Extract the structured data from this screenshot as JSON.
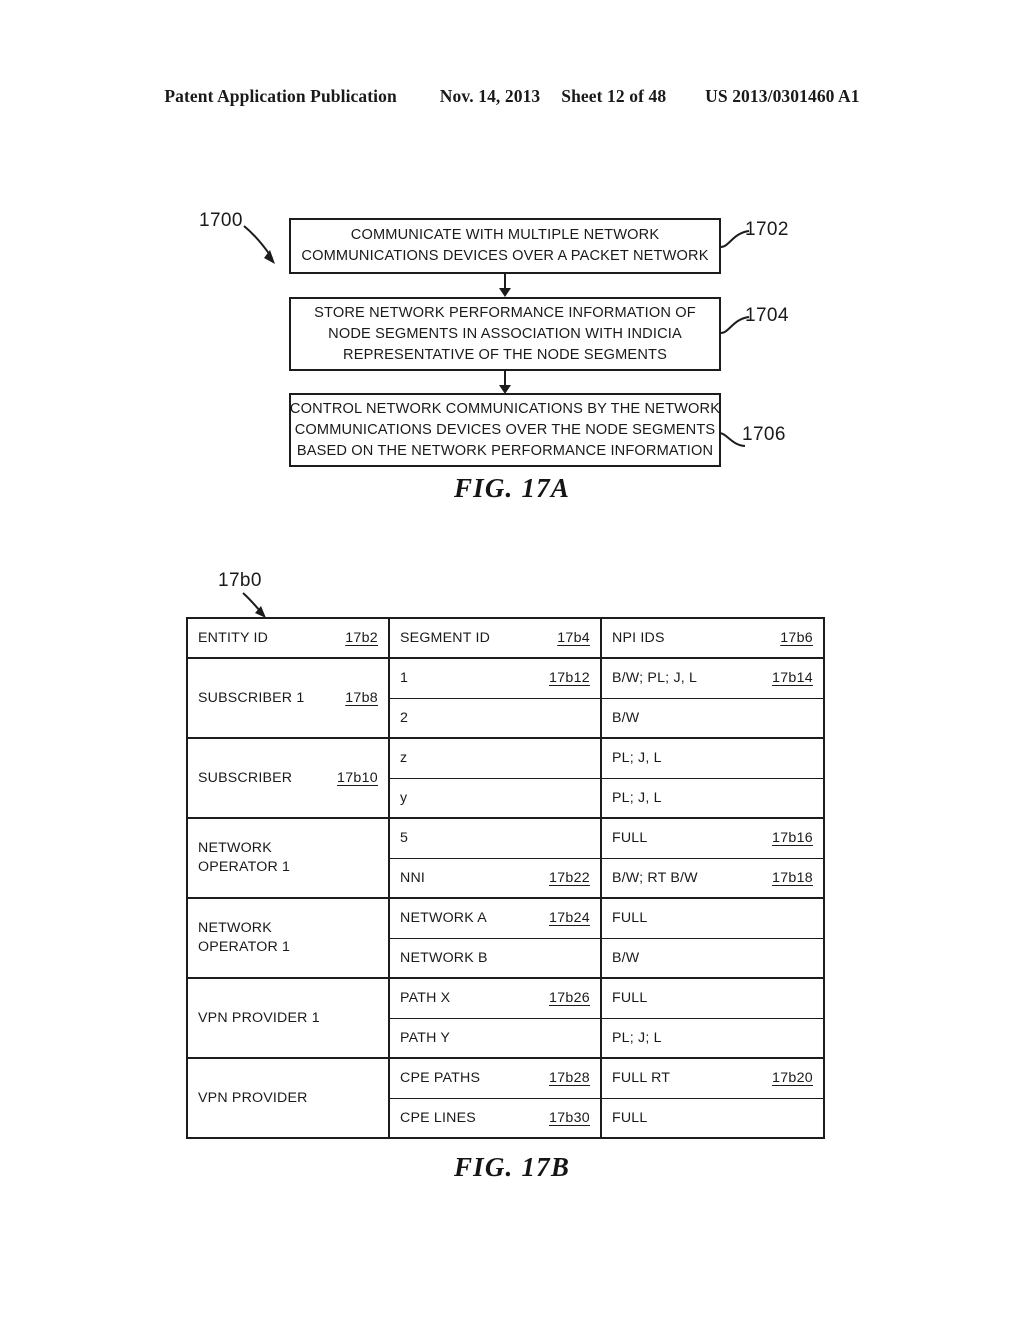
{
  "page_header": {
    "publication": "Patent Application Publication",
    "date": "Nov. 14, 2013",
    "sheet": "Sheet 12 of 48",
    "doc_number": "US 2013/0301460 A1"
  },
  "fig17a": {
    "caption": "FIG. 17A",
    "flow_ref": "1700",
    "steps": [
      {
        "ref": "1702",
        "lines": [
          "COMMUNICATE WITH MULTIPLE NETWORK",
          "COMMUNICATIONS DEVICES OVER A PACKET NETWORK"
        ]
      },
      {
        "ref": "1704",
        "lines": [
          "STORE NETWORK PERFORMANCE INFORMATION OF",
          "NODE SEGMENTS IN ASSOCIATION WITH INDICIA",
          "REPRESENTATIVE OF THE NODE SEGMENTS"
        ]
      },
      {
        "ref": "1706",
        "lines": [
          "CONTROL NETWORK COMMUNICATIONS BY THE NETWORK",
          "COMMUNICATIONS DEVICES OVER THE NODE SEGMENTS",
          "BASED ON THE NETWORK PERFORMANCE INFORMATION"
        ]
      }
    ]
  },
  "fig17b": {
    "caption": "FIG. 17B",
    "table_ref": "17b0",
    "headers": [
      {
        "label": "ENTITY ID",
        "ref": "17b2"
      },
      {
        "label": "SEGMENT ID",
        "ref": "17b4"
      },
      {
        "label": "NPI IDS",
        "ref": "17b6"
      }
    ],
    "groups": [
      {
        "entity_label": "SUBSCRIBER 1",
        "entity_label2": "",
        "entity_ref": "17b8",
        "rows": [
          {
            "segment": "1",
            "segment_ref": "17b12",
            "npi": "B/W; PL; J, L",
            "npi_ref": "17b14"
          },
          {
            "segment": "2",
            "segment_ref": "",
            "npi": "B/W",
            "npi_ref": ""
          }
        ]
      },
      {
        "entity_label": "SUBSCRIBER",
        "entity_label2": "",
        "entity_ref": "17b10",
        "rows": [
          {
            "segment": "z",
            "segment_ref": "",
            "npi": "PL; J, L",
            "npi_ref": ""
          },
          {
            "segment": "y",
            "segment_ref": "",
            "npi": "PL; J, L",
            "npi_ref": ""
          }
        ]
      },
      {
        "entity_label": "NETWORK",
        "entity_label2": "OPERATOR 1",
        "entity_ref": "",
        "rows": [
          {
            "segment": "5",
            "segment_ref": "",
            "npi": "FULL",
            "npi_ref": "17b16"
          },
          {
            "segment": "NNI",
            "segment_ref": "17b22",
            "npi": "B/W; RT B/W",
            "npi_ref": "17b18"
          }
        ]
      },
      {
        "entity_label": "NETWORK",
        "entity_label2": "OPERATOR 1",
        "entity_ref": "",
        "rows": [
          {
            "segment": "NETWORK A",
            "segment_ref": "17b24",
            "npi": "FULL",
            "npi_ref": ""
          },
          {
            "segment": "NETWORK B",
            "segment_ref": "",
            "npi": "B/W",
            "npi_ref": ""
          }
        ]
      },
      {
        "entity_label": "VPN PROVIDER 1",
        "entity_label2": "",
        "entity_ref": "",
        "rows": [
          {
            "segment": "PATH X",
            "segment_ref": "17b26",
            "npi": "FULL",
            "npi_ref": ""
          },
          {
            "segment": "PATH Y",
            "segment_ref": "",
            "npi": "PL; J; L",
            "npi_ref": ""
          }
        ]
      },
      {
        "entity_label": "VPN PROVIDER",
        "entity_label2": "",
        "entity_ref": "",
        "rows": [
          {
            "segment": "CPE PATHS",
            "segment_ref": "17b28",
            "npi": "FULL RT",
            "npi_ref": "17b20"
          },
          {
            "segment": "CPE LINES",
            "segment_ref": "17b30",
            "npi": "FULL",
            "npi_ref": ""
          }
        ]
      }
    ]
  }
}
